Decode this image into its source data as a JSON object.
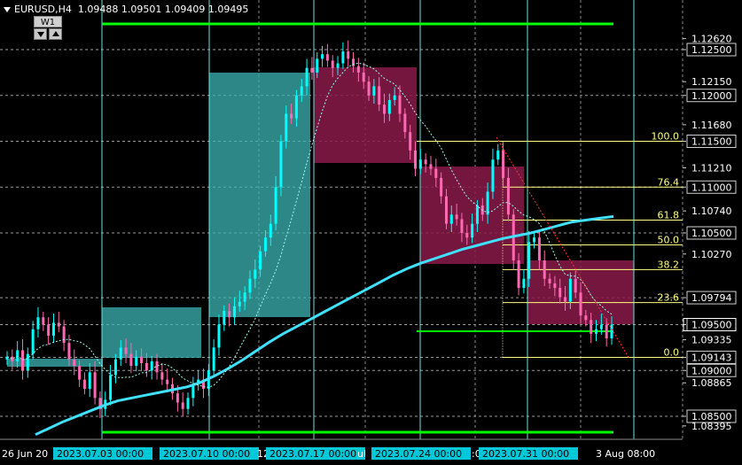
{
  "header": {
    "symbol_tf": "EURUSD,H4",
    "ohlc": "1.09488 1.09501 1.09409 1.09495"
  },
  "timeframe_switch": {
    "label": "W1"
  },
  "colors": {
    "background": "#000000",
    "candle_up": "#00ffff",
    "candle_down": "#ff69b4",
    "ma_line": "#40e0ff",
    "green_lines": "#00ff00",
    "fib": "#ffff80",
    "box_teal": "#3cb4b4",
    "box_pink": "#8a1a4a",
    "vlines": "#6fe0e0"
  },
  "price_axis": {
    "labels": [
      {
        "price": 1.1262,
        "text": "1.12620",
        "boxed": false
      },
      {
        "price": 1.125,
        "text": "1.12500",
        "boxed": true
      },
      {
        "price": 1.1215,
        "text": "1.12150",
        "boxed": false
      },
      {
        "price": 1.12,
        "text": "1.12000",
        "boxed": true
      },
      {
        "price": 1.1168,
        "text": "1.11680",
        "boxed": false
      },
      {
        "price": 1.115,
        "text": "1.11500",
        "boxed": true
      },
      {
        "price": 1.1121,
        "text": "1.11210",
        "boxed": false
      },
      {
        "price": 1.11,
        "text": "1.11000",
        "boxed": true
      },
      {
        "price": 1.1074,
        "text": "1.10740",
        "boxed": false
      },
      {
        "price": 1.105,
        "text": "1.10500",
        "boxed": true
      },
      {
        "price": 1.1027,
        "text": "1.10270",
        "boxed": false
      },
      {
        "price": 1.09794,
        "text": "1.09794",
        "boxed": true
      },
      {
        "price": 1.095,
        "text": "1.09500",
        "boxed": true
      },
      {
        "price": 1.09335,
        "text": "1.09335",
        "boxed": false
      },
      {
        "price": 1.09143,
        "text": "1.09143",
        "boxed": true
      },
      {
        "price": 1.09,
        "text": "1.09000",
        "boxed": true
      },
      {
        "price": 1.08865,
        "text": "1.08865",
        "boxed": false
      },
      {
        "price": 1.085,
        "text": "1.08500",
        "boxed": true
      },
      {
        "price": 1.08395,
        "text": "1.08395",
        "boxed": false
      }
    ]
  },
  "fib_levels": [
    {
      "label": "100.0",
      "price": 1.115
    },
    {
      "label": "76.4",
      "price": 1.11
    },
    {
      "label": "61.8",
      "price": 1.1064
    },
    {
      "label": "50.0",
      "price": 1.1037
    },
    {
      "label": "38.2",
      "price": 1.101
    },
    {
      "label": "23.6",
      "price": 1.0974
    },
    {
      "label": "0.0",
      "price": 1.09143
    }
  ],
  "time_axis": {
    "labels": [
      "26 Jun 20",
      "2023.07.03 00:00",
      "2023.07.10 00:00",
      "12",
      "2023.07.17 00:00",
      "ul",
      "2023.07.24 00:00",
      ":0",
      "2023.07.31 00:00",
      "3 Aug 08:00"
    ]
  },
  "chart_data": {
    "type": "candlestick",
    "symbol": "EURUSD",
    "timeframe": "H4",
    "ylim": [
      1.0828,
      1.1288
    ],
    "note_series": "EURUSD H4 candles, 28 Jun – 4 Aug 2023",
    "closes": [
      1.0915,
      1.091,
      1.0922,
      1.09,
      1.0918,
      1.0945,
      1.0958,
      1.095,
      1.0938,
      1.0952,
      1.0948,
      1.093,
      1.0912,
      1.0905,
      1.089,
      1.088,
      1.0898,
      1.087,
      1.0858,
      1.0868,
      1.0895,
      1.0912,
      1.0925,
      1.0918,
      1.0905,
      1.0915,
      1.0908,
      1.09,
      1.091,
      1.0898,
      1.089,
      1.0885,
      1.0875,
      1.0865,
      1.0858,
      1.087,
      1.0885,
      1.089,
      1.088,
      1.09,
      1.0925,
      1.095,
      1.0965,
      1.0958,
      1.097,
      1.0975,
      1.0985,
      1.1,
      1.101,
      1.103,
      1.1045,
      1.106,
      1.11,
      1.115,
      1.118,
      1.1175,
      1.12,
      1.121,
      1.123,
      1.1225,
      1.124,
      1.1245,
      1.1238,
      1.123,
      1.1235,
      1.1248,
      1.124,
      1.1232,
      1.1225,
      1.1215,
      1.12,
      1.121,
      1.119,
      1.118,
      1.1195,
      1.12,
      1.118,
      1.116,
      1.114,
      1.112,
      1.113,
      1.1125,
      1.112,
      1.111,
      1.109,
      1.106,
      1.107,
      1.1065,
      1.105,
      1.1045,
      1.106,
      1.108,
      1.107,
      1.1095,
      1.113,
      1.114,
      1.111,
      1.107,
      1.102,
      1.099,
      1.1,
      1.104,
      1.1045,
      1.102,
      1.1,
      1.0995,
      1.099,
      1.098,
      1.0975,
      1.1,
      1.0985,
      1.096,
      1.0955,
      1.094,
      1.0945,
      1.095,
      1.0935,
      1.095
    ]
  },
  "ma_series": {
    "name": "MA",
    "values": [
      1.083,
      1.0837,
      1.0844,
      1.085,
      1.0856,
      1.0862,
      1.0867,
      1.087,
      1.0873,
      1.0876,
      1.0879,
      1.0882,
      1.0887,
      1.0894,
      1.0902,
      1.0911,
      1.0921,
      1.0931,
      1.094,
      1.0948,
      1.0956,
      1.0964,
      1.0972,
      1.098,
      1.0988,
      1.0996,
      1.1004,
      1.1011,
      1.1017,
      1.1022,
      1.1027,
      1.1032,
      1.1036,
      1.104,
      1.1044,
      1.1047,
      1.105,
      1.1054,
      1.1058,
      1.1062,
      1.1064,
      1.1066,
      1.1068
    ]
  }
}
